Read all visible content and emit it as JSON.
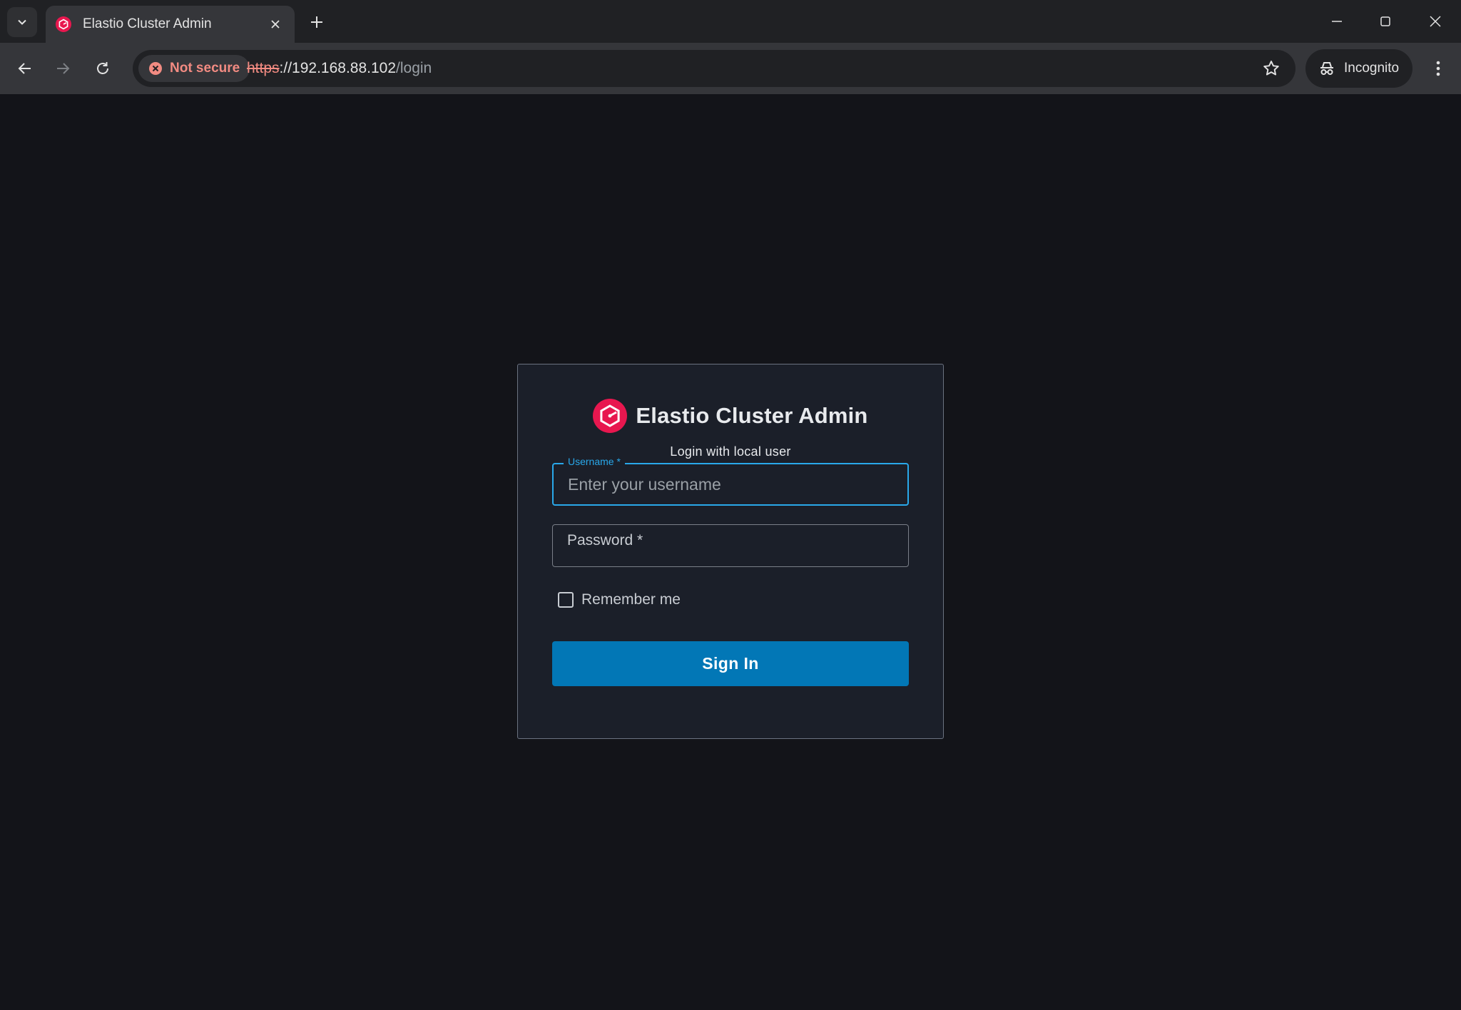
{
  "browser": {
    "tab_title": "Elastio Cluster Admin",
    "security_label": "Not secure",
    "url_scheme": "https",
    "url_host": "://192.168.88.102",
    "url_path": "/login",
    "incognito_label": "Incognito"
  },
  "login": {
    "app_title": "Elastio Cluster Admin",
    "subtitle": "Login with local user",
    "username_label": "Username *",
    "username_placeholder": "Enter your username",
    "password_label": "Password *",
    "remember_label": "Remember me",
    "signin_label": "Sign In"
  },
  "colors": {
    "page_background": "#131419",
    "card_background": "#1b1f29",
    "accent_blue": "#29a8ea",
    "button_blue": "#0277b6",
    "brand_pink": "#e8174f",
    "insecure_red": "#f28b82"
  },
  "icons": {
    "tab_search": "chevron-down-icon",
    "favicon": "elastio-logo-icon",
    "tab_close": "close-icon",
    "new_tab": "plus-icon",
    "minimize": "minimize-icon",
    "maximize": "maximize-icon",
    "close_window": "close-icon",
    "back": "arrow-left-icon",
    "forward": "arrow-right-icon",
    "reload": "reload-icon",
    "not_secure": "warning-circle-icon",
    "bookmark": "star-icon",
    "incognito": "incognito-icon",
    "menu": "kebab-menu-icon"
  }
}
